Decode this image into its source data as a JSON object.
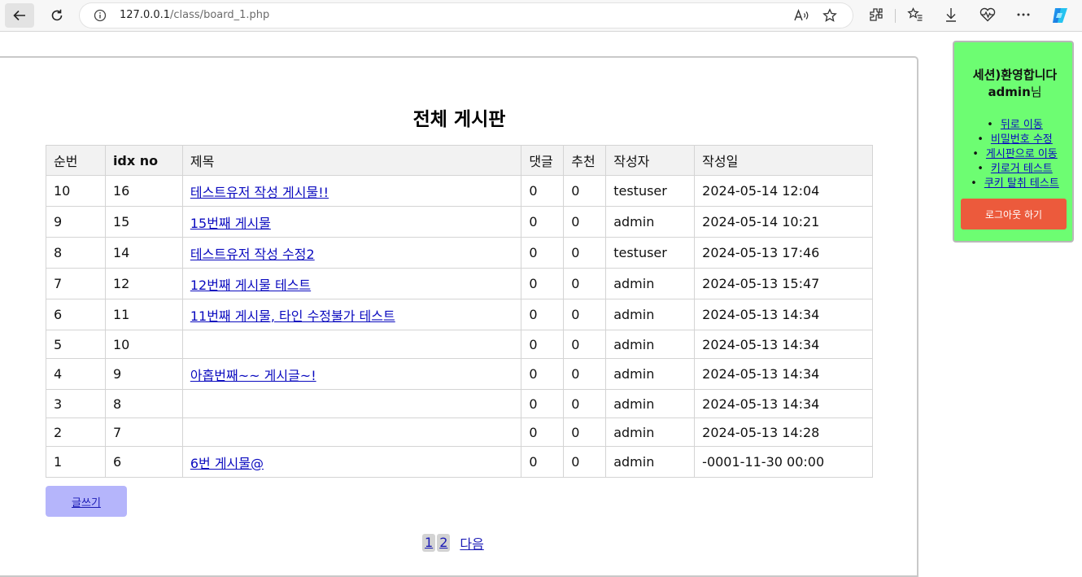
{
  "browser": {
    "url_host": "127.0.0.1",
    "url_path": "/class/board_1.php"
  },
  "board": {
    "title": "전체 게시판",
    "columns": [
      "순번",
      "idx no",
      "제목",
      "댓글",
      "추천",
      "작성자",
      "작성일"
    ],
    "rows": [
      {
        "num": "10",
        "idx": "16",
        "title": "테스트유저 작성 게시물!!",
        "comments": "0",
        "likes": "0",
        "author": "testuser",
        "date": "2024-05-14 12:04"
      },
      {
        "num": "9",
        "idx": "15",
        "title": "15번째 게시물",
        "comments": "0",
        "likes": "0",
        "author": "admin",
        "date": "2024-05-14 10:21"
      },
      {
        "num": "8",
        "idx": "14",
        "title": "테스트유저 작성 수정2",
        "comments": "0",
        "likes": "0",
        "author": "testuser",
        "date": "2024-05-13 17:46"
      },
      {
        "num": "7",
        "idx": "12",
        "title": "12번째 게시물 테스트",
        "comments": "0",
        "likes": "0",
        "author": "admin",
        "date": "2024-05-13 15:47"
      },
      {
        "num": "6",
        "idx": "11",
        "title": "11번째 게시물, 타인 수정불가 테스트",
        "comments": "0",
        "likes": "0",
        "author": "admin",
        "date": "2024-05-13 14:34"
      },
      {
        "num": "5",
        "idx": "10",
        "title": "",
        "comments": "0",
        "likes": "0",
        "author": "admin",
        "date": "2024-05-13 14:34"
      },
      {
        "num": "4",
        "idx": "9",
        "title": "아홉번째~~ 게시글~!",
        "comments": "0",
        "likes": "0",
        "author": "admin",
        "date": "2024-05-13 14:34"
      },
      {
        "num": "3",
        "idx": "8",
        "title": "",
        "comments": "0",
        "likes": "0",
        "author": "admin",
        "date": "2024-05-13 14:34"
      },
      {
        "num": "2",
        "idx": "7",
        "title": "",
        "comments": "0",
        "likes": "0",
        "author": "admin",
        "date": "2024-05-13 14:28"
      },
      {
        "num": "1",
        "idx": "6",
        "title": "6번 게시물@",
        "comments": "0",
        "likes": "0",
        "author": "admin",
        "date": "-0001-11-30 00:00"
      }
    ],
    "write_label": "글쓰기",
    "pages": [
      "1",
      "2"
    ],
    "next_label": "다음"
  },
  "session": {
    "welcome_prefix": "세션)환영합니다",
    "username": "admin",
    "suffix": "님",
    "links": [
      "뒤로 이동",
      "비밀번호 수정",
      "게시판으로 이동",
      "키로거 테스트",
      "쿠키 탈취 테스트"
    ],
    "logout_label": "로그아웃 하기"
  },
  "colors": {
    "session_bg": "#6dfd72",
    "logout_bg": "#ec5a3c",
    "write_bg": "#b5b5fb",
    "link": "#0b0bbf"
  }
}
